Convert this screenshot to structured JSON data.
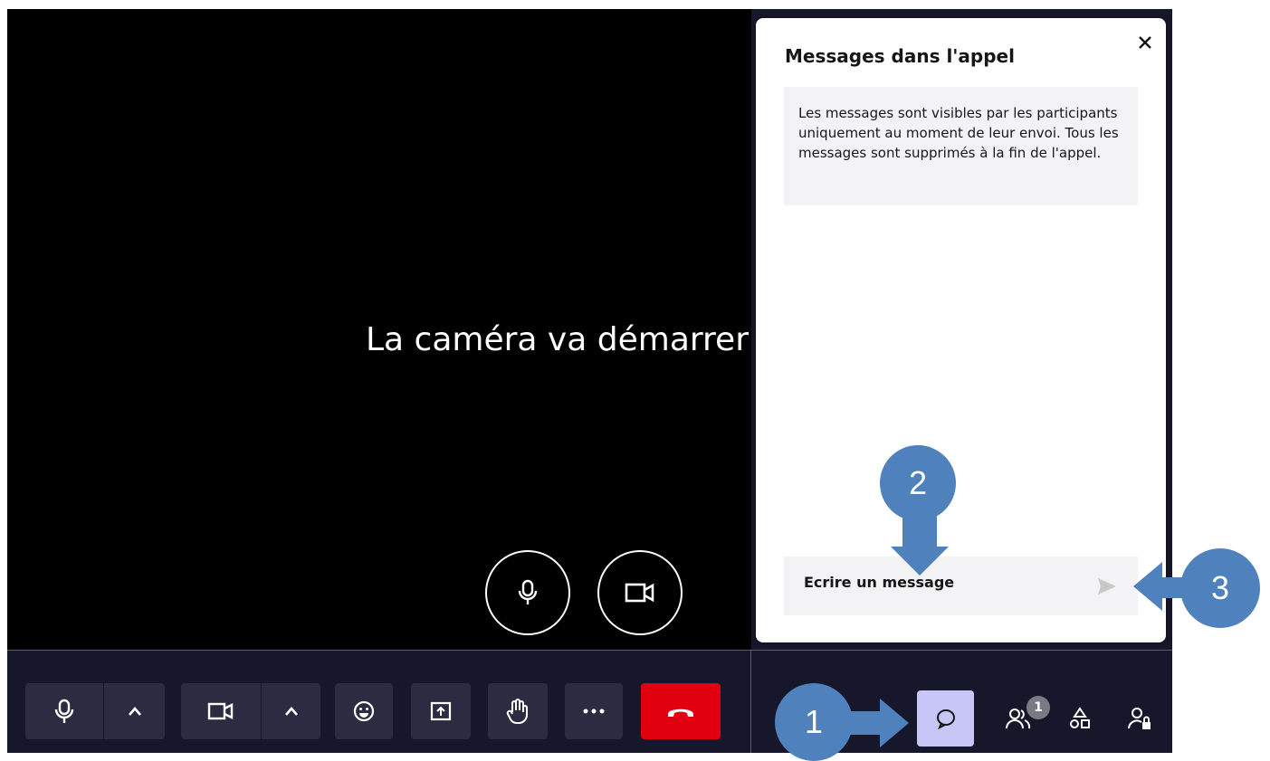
{
  "video": {
    "status_text": "La caméra va démarrer"
  },
  "controls_overlay": {
    "mic_icon": "microphone-icon",
    "camera_icon": "video-camera-icon"
  },
  "chat_panel": {
    "title": "Messages dans l'appel",
    "info_text": "Les messages sont visibles par les participants uniquement au moment de leur envoi. Tous les messages sont supprimés à la fin de l'appel.",
    "input_placeholder": "Ecrire un message",
    "close_icon": "close-icon",
    "send_icon": "send-icon"
  },
  "toolbar": {
    "left_buttons": [
      "microphone",
      "chevron-up",
      "video-camera",
      "chevron-up",
      "emoji",
      "screen-share",
      "raise-hand",
      "more",
      "hang-up"
    ],
    "right_buttons": [
      "chat",
      "participants",
      "activities",
      "host-controls"
    ],
    "participants_badge": "1",
    "hangup_color": "#e1000f",
    "active_color": "#c8c6f7"
  },
  "annotations": {
    "one": "1",
    "two": "2",
    "three": "3",
    "color": "#4f81bd"
  }
}
